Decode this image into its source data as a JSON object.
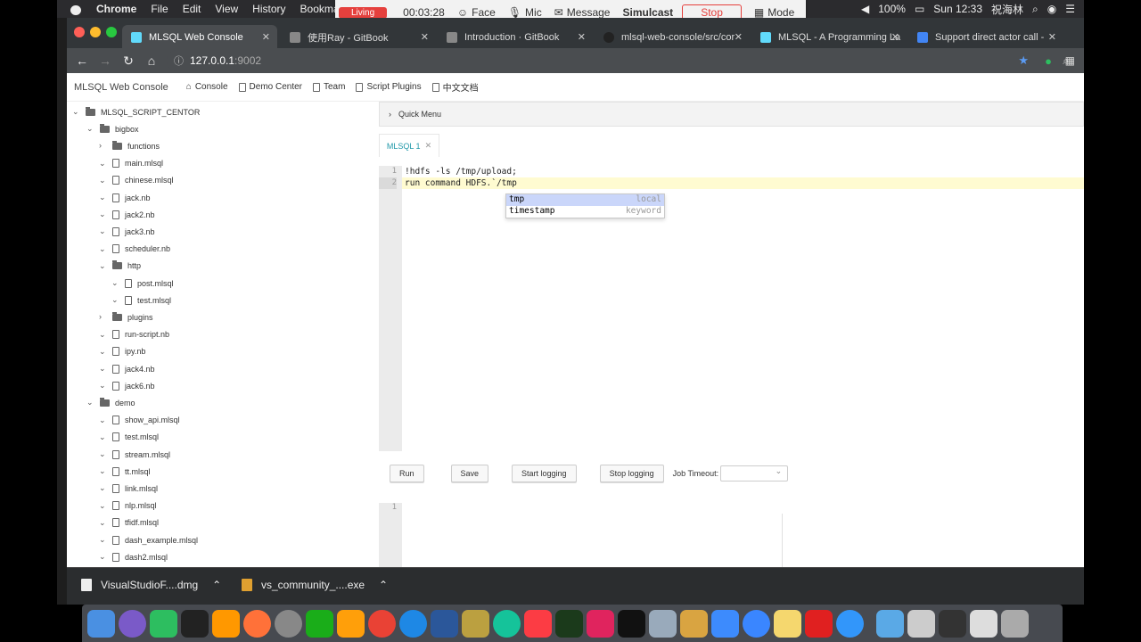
{
  "menubar": {
    "app": "Chrome",
    "items": [
      "File",
      "Edit",
      "View",
      "History",
      "Bookmark"
    ],
    "battery": "100%",
    "clock": "Sun 12:33",
    "user": "祝海林"
  },
  "recorder": {
    "status": "Living",
    "time": "00:03:28",
    "face": "Face",
    "mic": "Mic",
    "message": "Message",
    "simulcast": "Simulcast",
    "stop": "Stop",
    "mode": "Mode"
  },
  "browser": {
    "tabs": [
      {
        "title": "MLSQL Web Console"
      },
      {
        "title": "使用Ray - GitBook"
      },
      {
        "title": "Introduction · GitBook"
      },
      {
        "title": "mlsql-web-console/src/cor"
      },
      {
        "title": "MLSQL - A Programming La"
      },
      {
        "title": "Support direct actor call - "
      }
    ],
    "url_host": "127.0.0.1",
    "url_port": ":9002"
  },
  "topnav": {
    "brand": "MLSQL Web Console",
    "items": [
      "Console",
      "Demo Center",
      "Team",
      "Script Plugins",
      "中文文档"
    ]
  },
  "tree": {
    "root": "MLSQL_SCRIPT_CENTOR",
    "rows": [
      {
        "label": "bigbox",
        "type": "folder",
        "level": 1,
        "open": true
      },
      {
        "label": "functions",
        "type": "folder",
        "level": 2,
        "open": false
      },
      {
        "label": "main.mlsql",
        "type": "file",
        "level": 2
      },
      {
        "label": "chinese.mlsql",
        "type": "file",
        "level": 2
      },
      {
        "label": "jack.nb",
        "type": "file",
        "level": 2
      },
      {
        "label": "jack2.nb",
        "type": "file",
        "level": 2
      },
      {
        "label": "jack3.nb",
        "type": "file",
        "level": 2
      },
      {
        "label": "scheduler.nb",
        "type": "file",
        "level": 2
      },
      {
        "label": "http",
        "type": "folder",
        "level": 2,
        "open": true
      },
      {
        "label": "post.mlsql",
        "type": "file",
        "level": 3
      },
      {
        "label": "test.mlsql",
        "type": "file",
        "level": 3
      },
      {
        "label": "plugins",
        "type": "folder",
        "level": 2,
        "open": false
      },
      {
        "label": "run-script.nb",
        "type": "file",
        "level": 2
      },
      {
        "label": "ipy.nb",
        "type": "file",
        "level": 2
      },
      {
        "label": "jack4.nb",
        "type": "file",
        "level": 2
      },
      {
        "label": "jack6.nb",
        "type": "file",
        "level": 2
      },
      {
        "label": "demo",
        "type": "folder",
        "level": 1,
        "open": true
      },
      {
        "label": "show_api.mlsql",
        "type": "file",
        "level": 2
      },
      {
        "label": "test.mlsql",
        "type": "file",
        "level": 2
      },
      {
        "label": "stream.mlsql",
        "type": "file",
        "level": 2
      },
      {
        "label": "tt.mlsql",
        "type": "file",
        "level": 2
      },
      {
        "label": "link.mlsql",
        "type": "file",
        "level": 2
      },
      {
        "label": "nlp.mlsql",
        "type": "file",
        "level": 2
      },
      {
        "label": "tfidf.mlsql",
        "type": "file",
        "level": 2
      },
      {
        "label": "dash_example.mlsql",
        "type": "file",
        "level": 2
      },
      {
        "label": "dash2.mlsql",
        "type": "file",
        "level": 2
      }
    ]
  },
  "quick_menu": "Quick Menu",
  "editor_tab": "MLSQL 1",
  "editor": {
    "lines": [
      "!hdfs -ls /tmp/upload;",
      "run command HDFS.`/tmp"
    ],
    "line_numbers": [
      "1",
      "2"
    ],
    "autocomplete": [
      {
        "word": "tmp",
        "meta": "local"
      },
      {
        "word": "timestamp",
        "meta": "keyword"
      }
    ]
  },
  "actions": {
    "run": "Run",
    "save": "Save",
    "start_logging": "Start logging",
    "stop_logging": "Stop logging",
    "timeout_label": "Job Timeout:"
  },
  "output": {
    "line_number": "1"
  },
  "downloads": [
    {
      "name": "VisualStudioF....dmg"
    },
    {
      "name": "vs_community_....exe"
    }
  ],
  "colors": {
    "accent": "#2aa0b8",
    "record_red": "#e5403d",
    "cursor_line": "#fffbd1",
    "ac_selected": "#cad6fa"
  }
}
